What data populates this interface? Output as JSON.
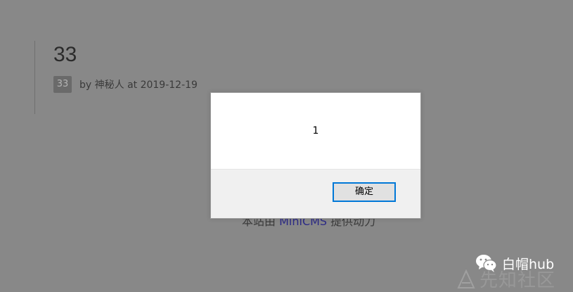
{
  "article": {
    "title": "33",
    "tag": "33",
    "meta": "by 神秘人 at 2019-12-19"
  },
  "footer": {
    "prefix": "本站由",
    "link": "MiniCMS",
    "suffix": "提供动力"
  },
  "dialog": {
    "message": "1",
    "ok_label": "确定"
  },
  "watermark": {
    "wechat_text": "白帽hub",
    "xz_text": "先知社区"
  },
  "colors": {
    "overlay_background": "#888888",
    "dialog_button_border": "#0078d7",
    "footer_link": "#2c2a86"
  }
}
